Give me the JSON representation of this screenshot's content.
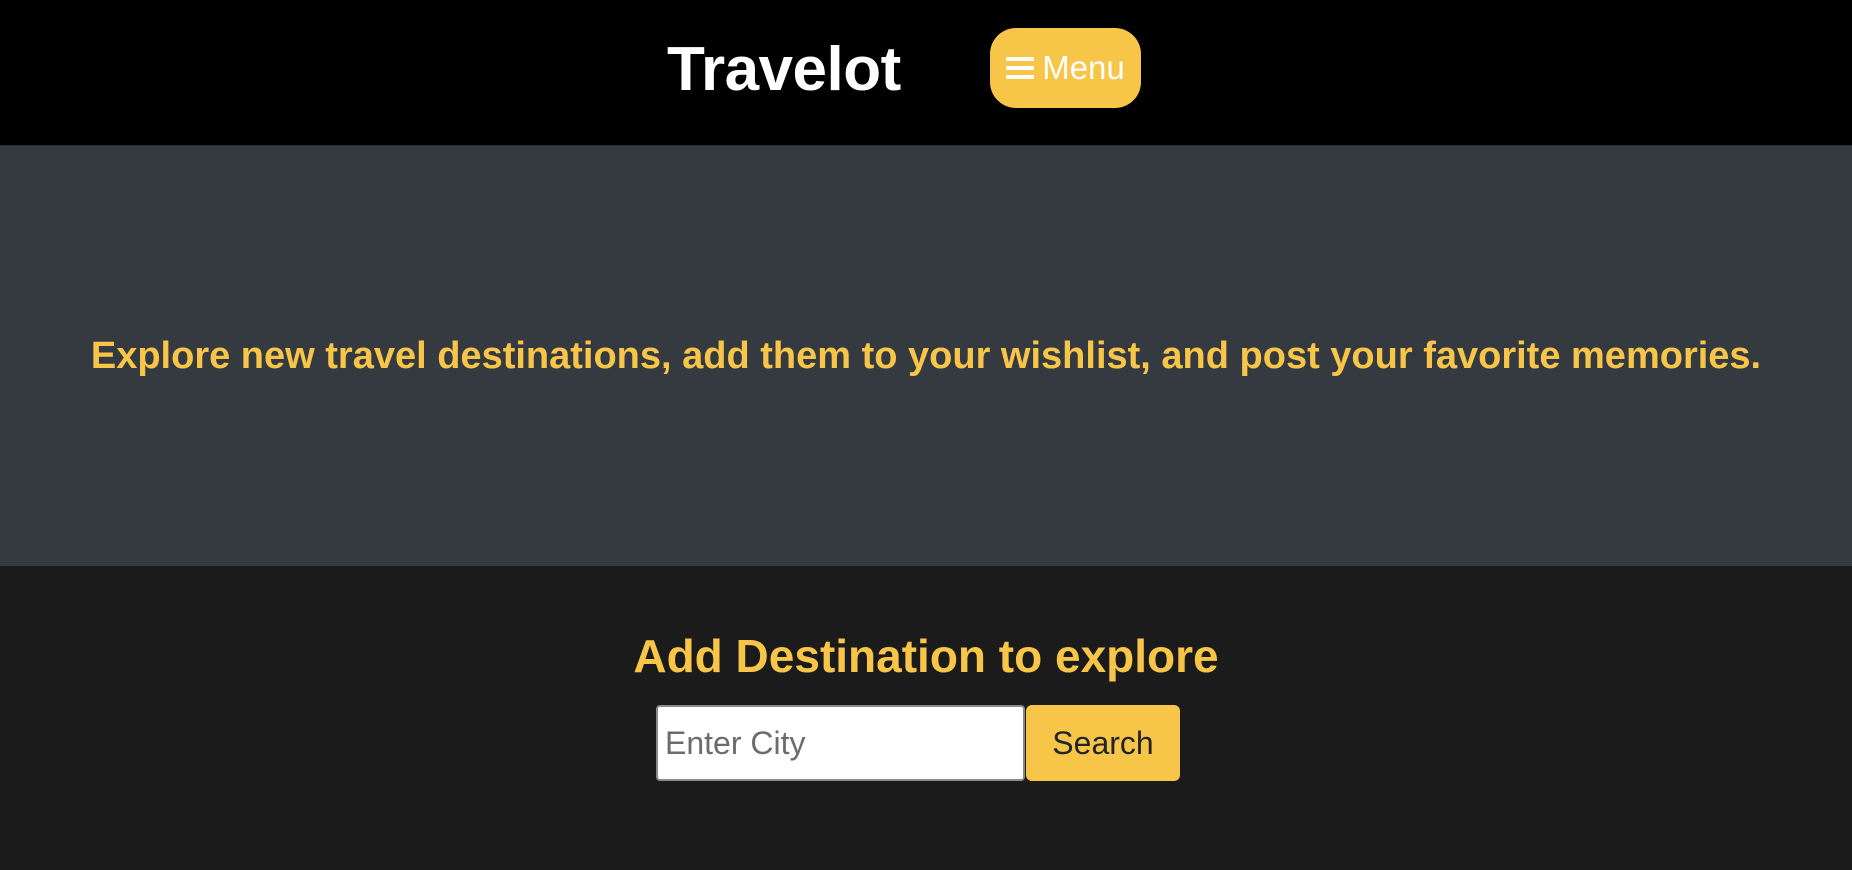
{
  "navbar": {
    "brand": "Travelot",
    "menu_label": "Menu",
    "menu_icon": "hamburger-icon"
  },
  "hero": {
    "tagline": "Explore new travel destinations, add them to your wishlist, and post your favorite memories."
  },
  "search": {
    "heading": "Add Destination to explore",
    "placeholder": "Enter City",
    "value": "",
    "button_label": "Search"
  },
  "colors": {
    "accent": "#f7c548",
    "navbar_bg": "#000000",
    "hero_bg": "#343a40",
    "section_bg": "#1b1b1b"
  }
}
